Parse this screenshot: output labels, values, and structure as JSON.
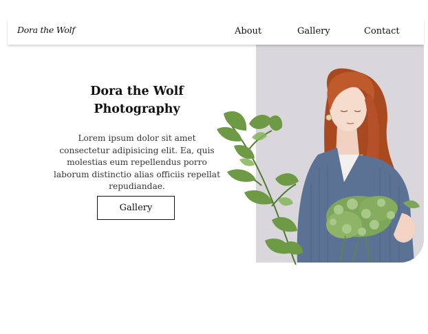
{
  "header": {
    "logo_text": "Dora the Wolf",
    "nav": {
      "about": "About",
      "gallery": "Gallery",
      "contact": "Contact"
    }
  },
  "hero": {
    "title_line1": "Dora the Wolf",
    "title_line2": "Photography",
    "description": "Lorem ipsum dolor sit amet consectetur adipisicing elit. Ea, quis molestias eum repellendus porro laborum distinctio alias officiis repellat repudiandae.",
    "button_label": "Gallery"
  },
  "colors": {
    "background": "#ffffff",
    "photo_backdrop": "#d9d7dc",
    "sweater": "#5b7294",
    "hair": "#b8552b",
    "leaves": "#6e9a45",
    "text": "#111111"
  }
}
